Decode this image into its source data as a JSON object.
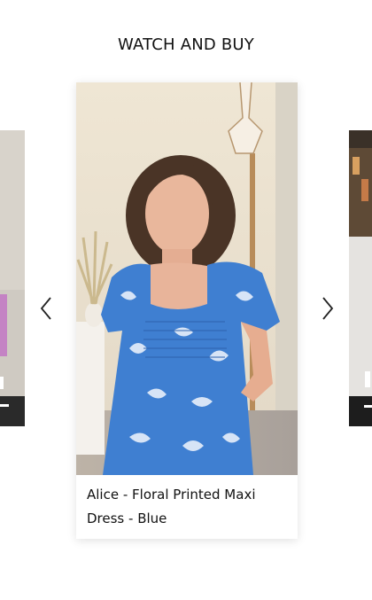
{
  "section": {
    "title": "WATCH AND BUY"
  },
  "carousel": {
    "prev_icon": "chevron-left-icon",
    "next_icon": "chevron-right-icon",
    "main_card": {
      "title": "Alice - Floral Printed Maxi Dress - Blue",
      "dress_color": "#3f7fd1",
      "bg_color": "#e9e2d2"
    }
  }
}
